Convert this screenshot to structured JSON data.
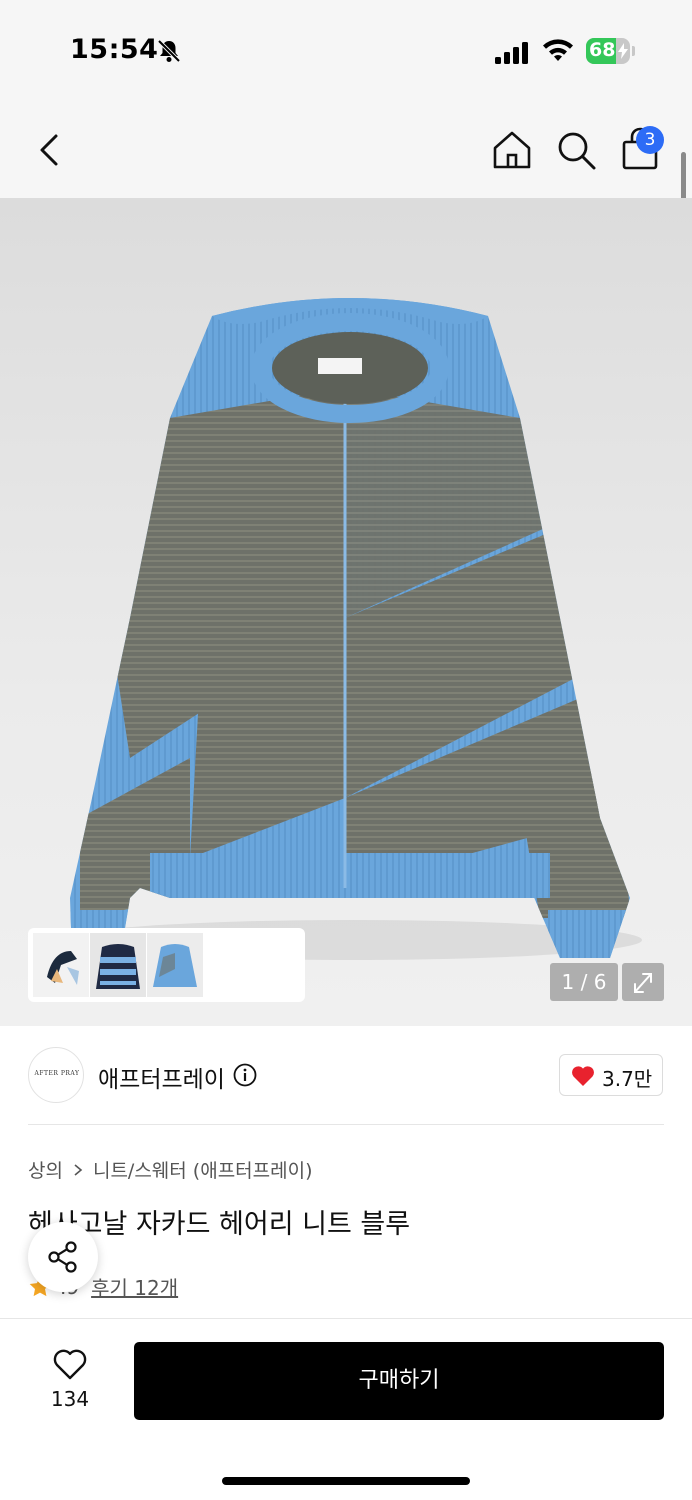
{
  "status_bar": {
    "time": "15:54",
    "battery_percent": "68",
    "battery_level": 0.68
  },
  "header": {
    "cart_count": "3"
  },
  "gallery": {
    "counter": "1 / 6",
    "thumbnail_count": 3
  },
  "brand": {
    "logo_text": "AFTER PRAY",
    "name": "애프터프레이",
    "like_count": "3.7만"
  },
  "product": {
    "breadcrumb": [
      "상의",
      "니트/스웨터 (애프터프레이)"
    ],
    "title": "헤사고날 자카드 헤어리 니트 블루",
    "rating": ".9",
    "review_link": "후기 12개"
  },
  "bottom_bar": {
    "wish_count": "134",
    "buy_label": "구매하기"
  },
  "colors": {
    "accent_blue": "#2d6cf6",
    "battery_green": "#34c759",
    "heart_red": "#e8222e",
    "star_orange": "#f5a623",
    "sweater_blue": "#6aa6dc",
    "sweater_dark": "#6e7169"
  }
}
